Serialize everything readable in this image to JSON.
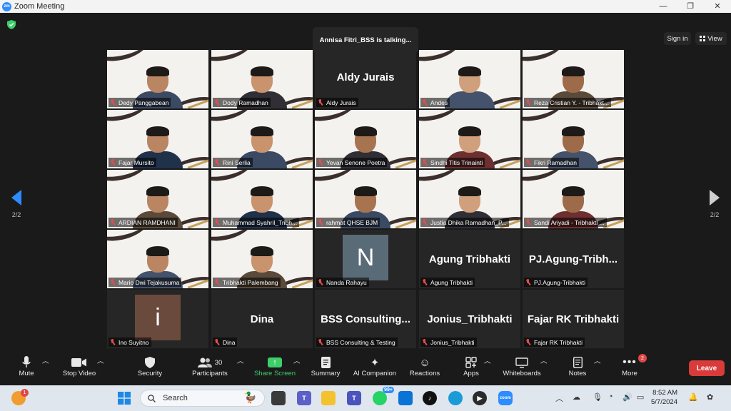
{
  "window": {
    "title": "Zoom Meeting",
    "app_icon": "zm",
    "minimize": "—",
    "maximize": "❐",
    "close": "✕"
  },
  "meeting": {
    "talking": "Annisa Fitri_BSS is talking...",
    "sign_in": "Sign in",
    "view": "View",
    "page_left": "2/2",
    "page_right": "2/2"
  },
  "tiles": [
    {
      "label": "Dedy Panggabean",
      "type": "video"
    },
    {
      "label": "Dody Ramadhan",
      "type": "video"
    },
    {
      "label": "Aldy Jurais",
      "type": "name",
      "big": "Aldy Jurais"
    },
    {
      "label": "Andes",
      "type": "video"
    },
    {
      "label": "Reza Cristian Y. - Tribhakt...",
      "type": "video"
    },
    {
      "label": "Fajar Mursito",
      "type": "video"
    },
    {
      "label": "Rini Serlia",
      "type": "video"
    },
    {
      "label": "Yevan Senone Poetra",
      "type": "video"
    },
    {
      "label": "Sindhi Titis Trinainti",
      "type": "video"
    },
    {
      "label": "Fikri Ramadhan",
      "type": "video"
    },
    {
      "label": "ARDIAN RAMDHANI",
      "type": "video"
    },
    {
      "label": "Muhammad Syahril_Tribh...",
      "type": "video"
    },
    {
      "label": "rahmat QHSE BJM",
      "type": "video"
    },
    {
      "label": "Justia Dhika Ramadhan_P...",
      "type": "video"
    },
    {
      "label": "Sandi Ariyadi - Tribhakti ...",
      "type": "video"
    },
    {
      "label": "Mario Dwi Tejakusuma",
      "type": "video"
    },
    {
      "label": "Tribhakti Palembang",
      "type": "video"
    },
    {
      "label": "Nanda Rahayu",
      "type": "avatar",
      "letter": "N"
    },
    {
      "label": "Agung Tribhakti",
      "type": "name",
      "big": "Agung Tribhakti"
    },
    {
      "label": "PJ.Agung-Tribhakti",
      "type": "name",
      "big": "PJ.Agung-Tribh..."
    },
    {
      "label": "Ino Suyitno",
      "type": "avatar",
      "letter": "i"
    },
    {
      "label": "Dina",
      "type": "name",
      "big": "Dina"
    },
    {
      "label": "BSS Consulting & Testing",
      "type": "name",
      "big": "BSS  Consulting..."
    },
    {
      "label": "Jonius_Tribhakti",
      "type": "name",
      "big": "Jonius_Tribhakti"
    },
    {
      "label": "Fajar RK Tribhakti",
      "type": "name",
      "big": "Fajar RK Tribhakti"
    }
  ],
  "toolbar": {
    "mute": "Mute",
    "stop_video": "Stop Video",
    "security": "Security",
    "participants": "Participants",
    "participants_count": "30",
    "share_screen": "Share Screen",
    "summary": "Summary",
    "ai_companion": "AI Companion",
    "reactions": "Reactions",
    "apps": "Apps",
    "whiteboards": "Whiteboards",
    "notes": "Notes",
    "more": "More",
    "more_badge": "2",
    "leave": "Leave"
  },
  "taskbar": {
    "search": "Search",
    "whatsapp_badge": "99+",
    "notif_badge": "1",
    "zoom_label": "zoom",
    "time": "8:52 AM",
    "date": "5/7/2024"
  },
  "colors": {
    "zoom_blue": "#2d8cff",
    "share_green": "#3ecf6b",
    "leave_red": "#d93a3a",
    "tile_bg": "#262626"
  }
}
